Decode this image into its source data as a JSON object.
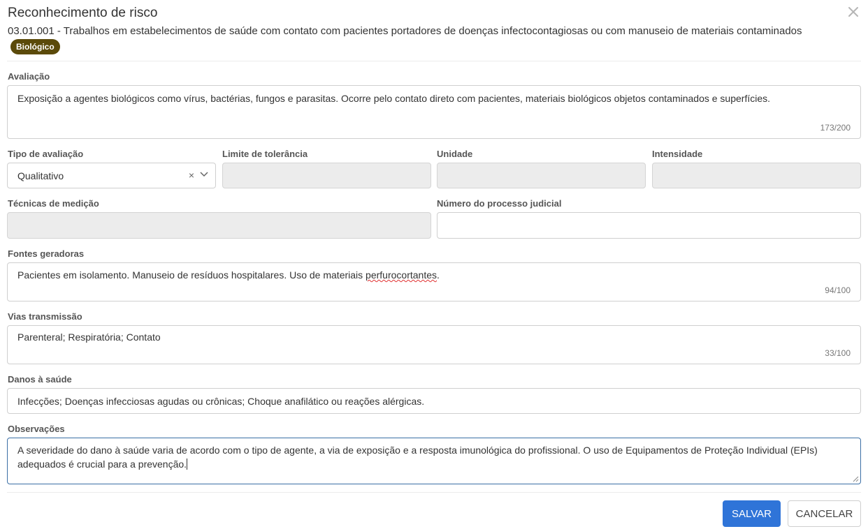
{
  "dialog": {
    "title": "Reconhecimento de risco",
    "subtitle": "03.01.001 - Trabalhos em estabelecimentos de saúde com contato com pacientes portadores de doenças infectocontagiosas ou com manuseio de materiais contaminados",
    "badge": "Biológico",
    "close_icon": "close-icon"
  },
  "form": {
    "avaliacao": {
      "label": "Avaliação",
      "value": "Exposição a agentes biológicos como vírus, bactérias, fungos e parasitas. Ocorre pelo contato direto com pacientes, materiais biológicos  objetos contaminados e superfícies.",
      "counter": "173/200"
    },
    "tipo_avaliacao": {
      "label": "Tipo de avaliação",
      "value": "Qualitativo",
      "clear_glyph": "×"
    },
    "limite_tolerancia": {
      "label": "Limite de tolerância",
      "value": ""
    },
    "unidade": {
      "label": "Unidade",
      "value": ""
    },
    "intensidade": {
      "label": "Intensidade",
      "value": ""
    },
    "tecnicas_medicao": {
      "label": "Técnicas de medição",
      "value": ""
    },
    "numero_processo": {
      "label": "Número do processo judicial",
      "value": ""
    },
    "fontes_geradoras": {
      "label": "Fontes geradoras",
      "value_before": "Pacientes em isolamento. Manuseio de resíduos hospitalares. Uso de materiais ",
      "value_misspelled": "perfurocortantes",
      "value_after": ".",
      "counter": "94/100"
    },
    "vias_transmissao": {
      "label": "Vias transmissão",
      "value": "Parenteral; Respiratória; Contato",
      "counter": "33/100"
    },
    "danos_saude": {
      "label": "Danos à saúde",
      "value": "Infecções;  Doenças infecciosas agudas ou crônicas; Choque anafilático ou reações alérgicas."
    },
    "observacoes": {
      "label": "Observações",
      "value": "A severidade do dano à saúde varia de acordo com o tipo de agente, a via de exposição e a resposta imunológica do profissional. O uso de Equipamentos de Proteção Individual (EPIs) adequados é crucial para a prevenção."
    }
  },
  "footer": {
    "save_label": "SALVAR",
    "cancel_label": "CANCELAR"
  },
  "colors": {
    "badge_bg": "#5b4a0a",
    "primary": "#2f74d8",
    "disabled_bg": "#ececec",
    "focus_border": "#3a6ea5"
  }
}
